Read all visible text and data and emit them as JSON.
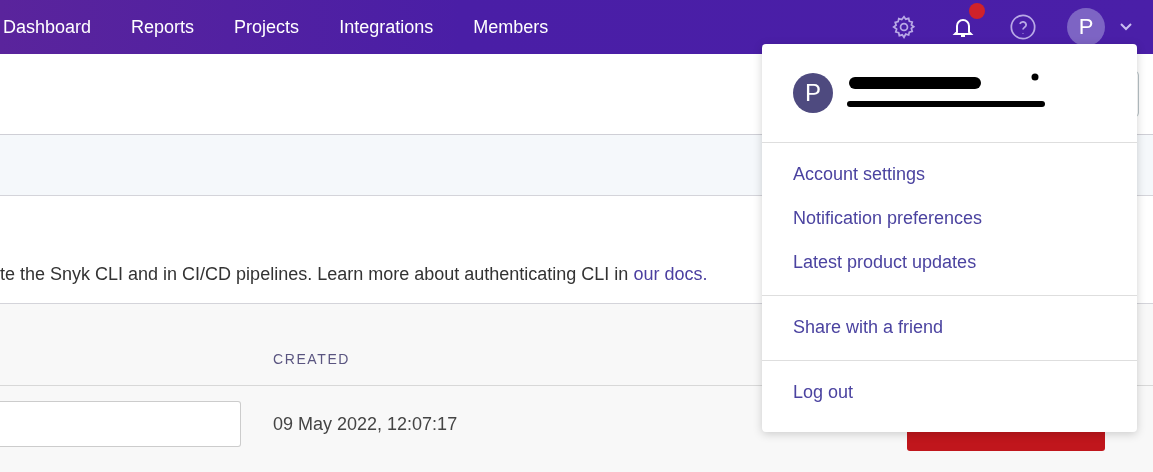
{
  "nav": {
    "items": [
      "Dashboard",
      "Reports",
      "Projects",
      "Integrations",
      "Members"
    ],
    "avatar_letter": "P"
  },
  "description": {
    "text": "te the Snyk CLI and in CI/CD pipelines. Learn more about authenticating CLI in ",
    "link": "our docs."
  },
  "table": {
    "columns": [
      "CREATED"
    ],
    "rows": [
      {
        "created": "09 May 2022, 12:07:17"
      }
    ]
  },
  "user_menu": {
    "avatar_letter": "P",
    "sections": [
      [
        "Account settings",
        "Notification preferences",
        "Latest product updates"
      ],
      [
        "Share with a friend"
      ],
      [
        "Log out"
      ]
    ]
  }
}
